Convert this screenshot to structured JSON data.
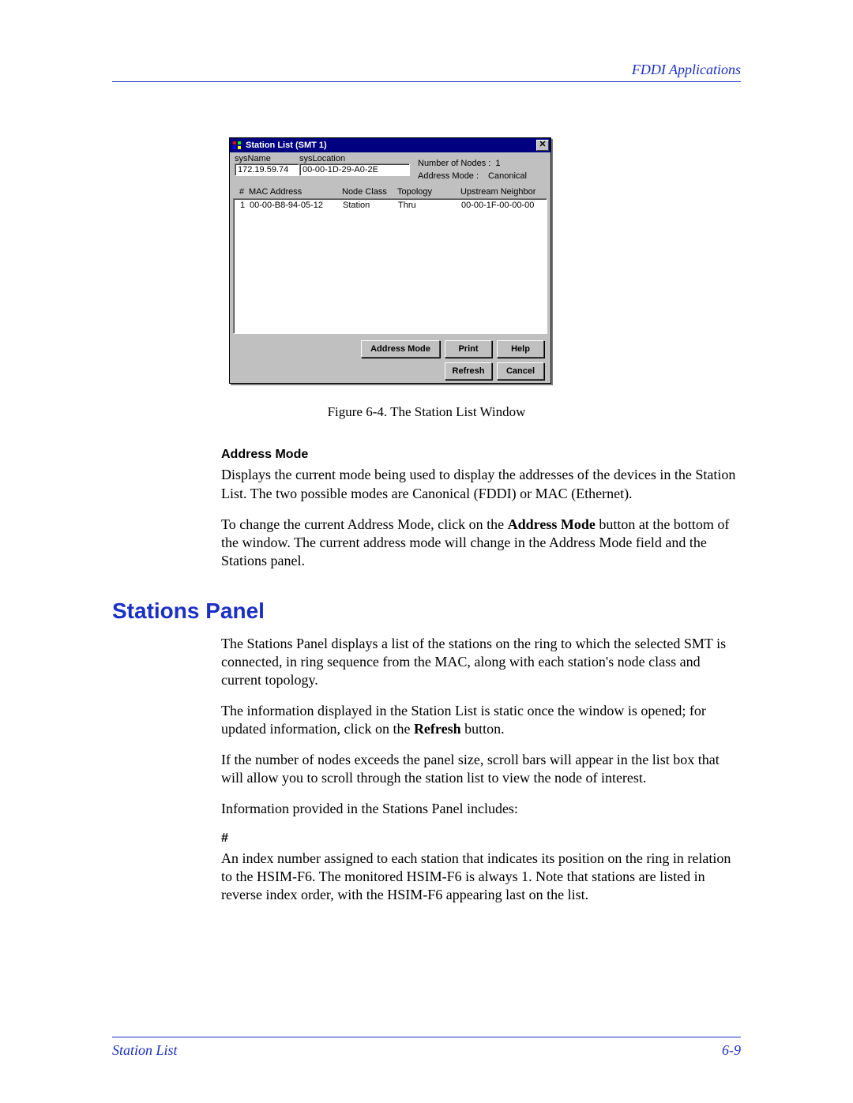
{
  "header": {
    "chapter": "FDDI Applications"
  },
  "dialog": {
    "title": "Station List (SMT 1)",
    "close_glyph": "✕",
    "sysname_label": "sysName",
    "sysname_value": "172.19.59.74",
    "syslocation_label": "sysLocation",
    "syslocation_value": "00-00-1D-29-A0-2E",
    "numnodes_label": "Number of Nodes :",
    "numnodes_value": "1",
    "addrmode_label": "Address Mode :",
    "addrmode_value": "Canonical",
    "cols": {
      "num": "#",
      "mac": "MAC Address",
      "node": "Node Class",
      "topo": "Topology",
      "neigh": "Upstream Neighbor"
    },
    "rows": [
      {
        "num": "1",
        "mac": "00-00-B8-94-05-12",
        "node": "Station",
        "topo": "Thru",
        "neigh": "00-00-1F-00-00-00"
      }
    ],
    "buttons": {
      "address_mode": "Address Mode",
      "print": "Print",
      "help": "Help",
      "refresh": "Refresh",
      "cancel": "Cancel"
    }
  },
  "figcap": "Figure 6-4. The Station List Window",
  "sect_addrmode": {
    "title": "Address Mode",
    "p1": "Displays the current mode being used to display the addresses of the devices in the Station List. The two possible modes are Canonical (FDDI) or MAC (Ethernet).",
    "p2_a": "To change the current Address Mode, click on the ",
    "p2_b": "Address Mode",
    "p2_c": " button at the bottom of the window. The current address mode will change in the Address Mode field and the Stations panel."
  },
  "sect_stations": {
    "heading": "Stations Panel",
    "p1": "The Stations Panel displays a list of the stations on the ring to which the selected SMT is connected, in ring sequence from the MAC, along with each station's node class and current topology.",
    "p2_a": "The information displayed in the Station List is static once the window is opened; for updated information, click on the ",
    "p2_b": "Refresh",
    "p2_c": " button.",
    "p3": "If the number of nodes exceeds the panel size, scroll bars will appear in the list box that will allow you to scroll through the station list to view the node of interest.",
    "p4": "Information provided in the Stations Panel includes:",
    "hash_title": "#",
    "hash_body": "An index number assigned to each station that indicates its position on the ring in relation to the HSIM-F6. The monitored HSIM-F6 is always 1. Note that stations are listed in reverse index order, with the HSIM-F6 appearing last on the list."
  },
  "footer": {
    "left": "Station List",
    "right": "6-9"
  }
}
